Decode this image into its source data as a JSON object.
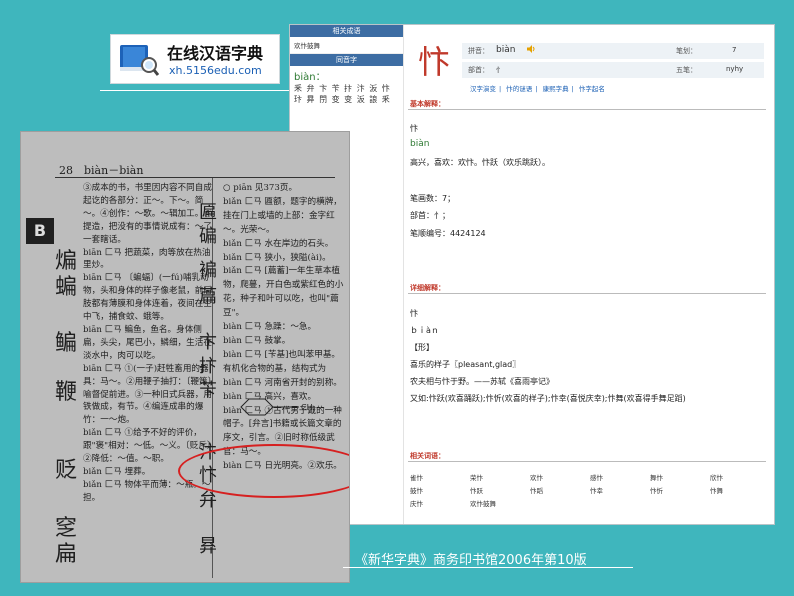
{
  "logo": {
    "name": "在线汉语字典",
    "url": "xh.5156edu.com"
  },
  "left_column": {
    "idiom_header": "相关成语",
    "idiom": "欢忭鼓舞",
    "homophone_header": "同音字",
    "homophone_pinyin": "biàn：",
    "homophone_chars": "釆 弁 卞 苄 抃 汴 汳 忭 玣 昪 閅 变 变 汳 誏 釆"
  },
  "entry": {
    "character": "忭",
    "pinyin_label": "拼音：",
    "pinyin_value": "biàn",
    "bihua_label": "笔划：",
    "bihua_value": "7",
    "bushou_label": "部首：",
    "bushou_value": "忄",
    "wubi_label": "五笔：",
    "wubi_value": "nyhy",
    "nav_links": [
      "汉字演变",
      "忭的谜语",
      "康熙字典",
      "忭字起名"
    ],
    "nav_sep": "|"
  },
  "basic": {
    "header": "基本解释：",
    "lines": [
      "忭",
      "biàn",
      "高兴，喜欢：欢忭。忭跃（欢乐跳跃）。",
      "",
      "笔画数：7；",
      "部首：忄；",
      "笔顺编号：4424124"
    ]
  },
  "detail": {
    "header": "详细解释：",
    "lines": [
      "忭",
      "ｂｉàｎ",
      "【形】",
      "喜乐的样子〖pleasant,glad〗",
      "农夫相与忭于野。——苏轼《喜雨亭记》",
      "又如:忭跃(欢喜踊跃);忭忻(欢喜的样子);忭幸(喜悦庆幸);忭舞(欢喜得手舞足蹈)"
    ]
  },
  "related": {
    "header": "相关词语：",
    "words": [
      "雀忭",
      "荣忭",
      "欢忭",
      "感忭",
      "舞忭",
      "欣忭",
      "鼓忭",
      "忭跃",
      "忭蹈",
      "忭幸",
      "忭忻",
      "忭舞",
      "庆忭",
      "欢忭鼓舞"
    ]
  },
  "photo": {
    "header": "28　biàn－biàn",
    "left_text": "③成本的书，书里因内容不同自成起讫的各部分：正～。下～。简～。④创作：～歌。～辑加工。⑤提造，把没有的事情说成有：～了一套瞎话。\nbiān 匚ㄢ 把蔬菜，肉等放在热油里炒。\nbiān 匚ㄢ 〔蝙蝠〕(一fú)哺乳动物，头和身体的样子像老鼠，前后肢都有薄膜和身体连着，夜间在空中飞，捕食蚊、蛾等。\nbiān 匚ㄢ 鳊鱼，鱼名。身体侧扁，头尖，尾巴小，鳞细，生活在淡水中，肉可以吃。\nbiān 匚ㄢ ①(一子)赶牲畜用的器具：马～。②用鞭子抽打：〔鞭策〕喻督促前进。③一种旧式兵器，用铁做成，有节。④编连成串的爆竹：一～炮。\nbiǎn 匚ㄢ ①给予不好的评价，跟\"褒\"相对：～低。～义。〔贬斥〕②降低：～值。～职。\nbiǎn 匚ㄢ 埋葬。\nbiǎn 匚ㄢ 物体平而薄：～瓶。～担。",
    "big_chars": [
      "煸",
      "蝙",
      "鳊",
      "鞭",
      "贬",
      "窆",
      "扁"
    ],
    "right_text": "○ piān 见373页。\nbiǎn 匚ㄢ 匾额，题字的横牌，挂在门上或墙的上部：金字红～。光荣～。\nbiǎn 匚ㄢ 水在岸边的石头。\nbiǎn 匚ㄢ 狭小，狭隘(ài)。\nbiǎn 匚ㄢ [萹蓄]一年生草本植物，爬蔓，开白色或紫红色的小花，种子和叶可以吃，也叫\"萹豆\"。\nbiàn 匚ㄢ 急躁：～急。\nbiàn 匚ㄢ 鼓掌。\nbiàn 匚ㄢ [苄基]也叫苯甲基。有机化合物的基，结构式为\nbiàn 匚ㄢ 河南省开封的别称。\nbiàn 匚ㄢ 高兴，喜欢。\nbiàn 匚ㄢ ①古代男子戴的一种帽子。[弁言]书籍或长篇文章的序文，引言。②旧时称低级武官：马～。\nbiàn 匚ㄢ 日光明亮。②欢乐。",
    "right_chars": [
      "匾",
      "碥",
      "褊",
      "萹",
      "卞",
      "抃",
      "苄",
      "汴",
      "忭",
      "弁",
      "昪"
    ],
    "tab": "B"
  },
  "caption": "《新华字典》商务印书馆2006年第10版",
  "colors": {
    "background": "#3fb6bd",
    "highlight": "#d62020",
    "header_blue": "#3d6da3",
    "pinyin_green": "#2f7a34"
  }
}
